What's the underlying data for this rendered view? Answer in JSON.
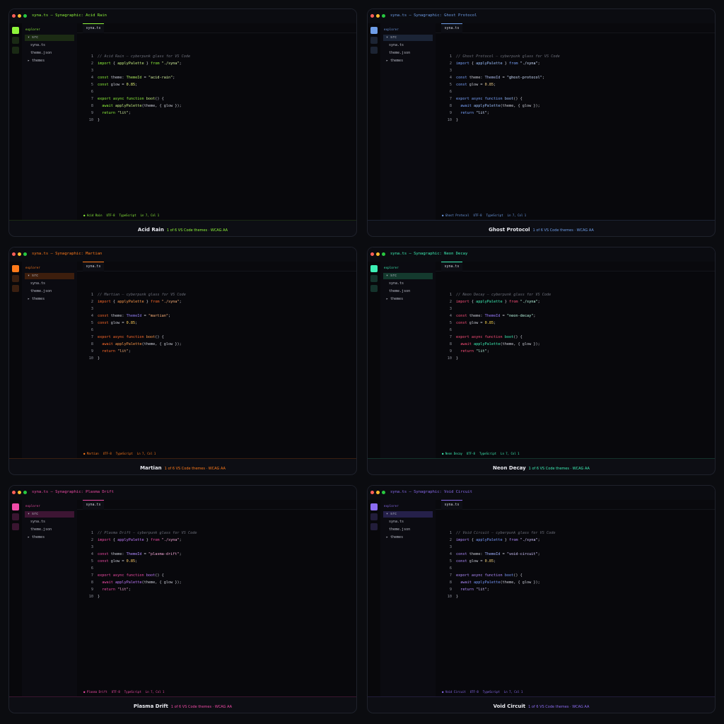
{
  "window": {
    "title_prefix": "syna.ts — Synagraphic: ",
    "explorer_label": "EXPLORER",
    "tree": [
      "▾ src",
      "syna.ts",
      "theme.json",
      "▸ themes"
    ],
    "tab_label": "syna.ts",
    "status": {
      "encoding": "UTF-8",
      "language": "TypeScript",
      "position": "Ln 7, Col 1"
    }
  },
  "caption_meta": "1 of 6 VS Code themes · WCAG AA",
  "themes": [
    {
      "name": "Acid Rain",
      "title": "syna.ts — Synagraphic: Acid Rain",
      "slug": "acid-rain",
      "status_name": "● Acid Rain",
      "colors": {
        "accent": "#8ef53a",
        "dim": "#1a2a14",
        "sel": "#1c2b14",
        "kw": "#8ef53a",
        "fn": "#c6f080",
        "str": "#d7f5a0",
        "ty": "#a9e45d",
        "num": "#e4f77a"
      }
    },
    {
      "name": "Ghost Protocol",
      "title": "syna.ts — Synagraphic: Ghost Protocol",
      "slug": "ghost-protocol",
      "status_name": "● Ghost Protocol",
      "colors": {
        "accent": "#6f9ee8",
        "dim": "#1c2433",
        "sel": "#1b2436",
        "kw": "#7aa4ff",
        "fn": "#9cc1ff",
        "str": "#cfe0ff",
        "ty": "#a9b8e8",
        "num": "#f2d08a"
      }
    },
    {
      "name": "Martian",
      "title": "syna.ts — Synagraphic: Martian",
      "slug": "martian",
      "status_name": "● Martian",
      "colors": {
        "accent": "#ff7a1a",
        "dim": "#3a1f10",
        "sel": "#3d1e0d",
        "kw": "#ff6a2a",
        "fn": "#ff9a4a",
        "str": "#ffb37a",
        "ty": "#8f7cf0",
        "num": "#ffcf5a"
      }
    },
    {
      "name": "Neon Decay",
      "title": "syna.ts — Synagraphic: Neon Decay",
      "slug": "neon-decay",
      "status_name": "● Neon Decay",
      "colors": {
        "accent": "#3df0b5",
        "dim": "#14332b",
        "sel": "#143a2e",
        "kw": "#ff4f7a",
        "fn": "#3df0b5",
        "str": "#b8f7e0",
        "ty": "#9a7cff",
        "num": "#ffd84d"
      }
    },
    {
      "name": "Plasma Drift",
      "title": "syna.ts — Synagraphic: Plasma Drift",
      "slug": "plasma-drift",
      "status_name": "● Plasma Drift",
      "colors": {
        "accent": "#f04ba6",
        "dim": "#3a1530",
        "sel": "#3d1533",
        "kw": "#f04ba6",
        "fn": "#c27bff",
        "str": "#f7a8d8",
        "ty": "#b08cff",
        "num": "#ffce6a"
      }
    },
    {
      "name": "Void Circuit",
      "title": "syna.ts — Synagraphic: Void Circuit",
      "slug": "void-circuit",
      "status_name": "● Void Circuit",
      "colors": {
        "accent": "#8b6cf0",
        "dim": "#221d3a",
        "sel": "#25204a",
        "kw": "#b08cff",
        "fn": "#7a9cff",
        "str": "#d2c6ff",
        "ty": "#9fb0ff",
        "num": "#f4d27a"
      }
    }
  ]
}
